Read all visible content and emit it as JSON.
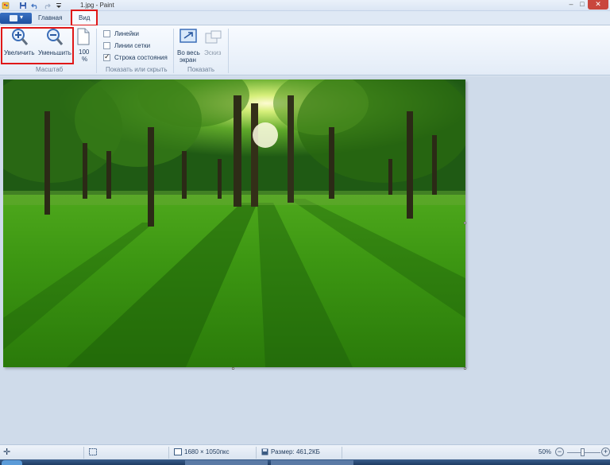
{
  "window": {
    "title": "1.jpg - Paint",
    "minimize_glyph": "–",
    "maximize_glyph": "□",
    "close_glyph": "✕"
  },
  "quick_access": {
    "icons": [
      "paint-app-icon",
      "save-icon",
      "undo-icon",
      "redo-icon",
      "customize-dropdown-icon"
    ]
  },
  "tabs": {
    "home": "Главная",
    "view": "Вид"
  },
  "ribbon": {
    "zoom_group": {
      "label": "Масштаб",
      "zoom_in": "Увеличить",
      "zoom_out": "Уменьшить",
      "hundred_line1": "100",
      "hundred_line2": "%"
    },
    "show_hide_group": {
      "label": "Показать или скрыть",
      "rulers": "Линейки",
      "gridlines": "Линии сетки",
      "statusbar": "Строка состояния",
      "rulers_checked": false,
      "gridlines_checked": false,
      "statusbar_checked": true
    },
    "display_group": {
      "label": "Показать",
      "fullscreen_line1": "Во весь",
      "fullscreen_line2": "экран",
      "thumbnail": "Эскиз"
    }
  },
  "status": {
    "dimensions": "1680 × 1050пкс",
    "size": "Размер: 461,2КБ",
    "zoom": "50%",
    "zoom_out_glyph": "−",
    "zoom_in_glyph": "+"
  },
  "colors": {
    "highlight": "#e01818",
    "accent": "#1d4f9e"
  }
}
